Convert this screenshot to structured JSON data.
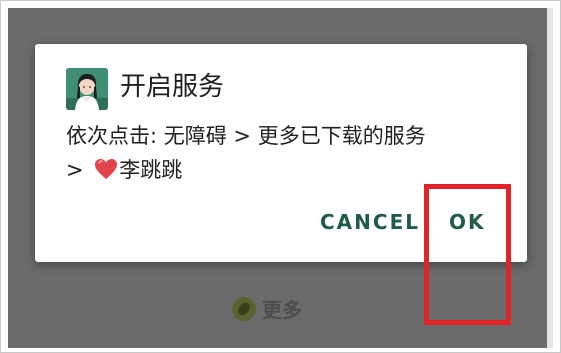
{
  "dialog": {
    "title": "开启服务",
    "message_line1": "依次点击: 无障碍 > 更多已下载的服务",
    "message_line2_prefix": ">",
    "message_line2_suffix": "李跳跳",
    "cancel_label": "CANCEL",
    "ok_label": "OK"
  },
  "background": {
    "more_label": "更多"
  },
  "icons": {
    "app": "app-avatar-icon",
    "heart": "heart-icon",
    "more": "more-icon"
  },
  "colors": {
    "scrim": "#6b6b6b",
    "dialog_bg": "#ffffff",
    "button_text": "#205a4a",
    "highlight": "#e2232a",
    "heart": "#e0454c"
  }
}
